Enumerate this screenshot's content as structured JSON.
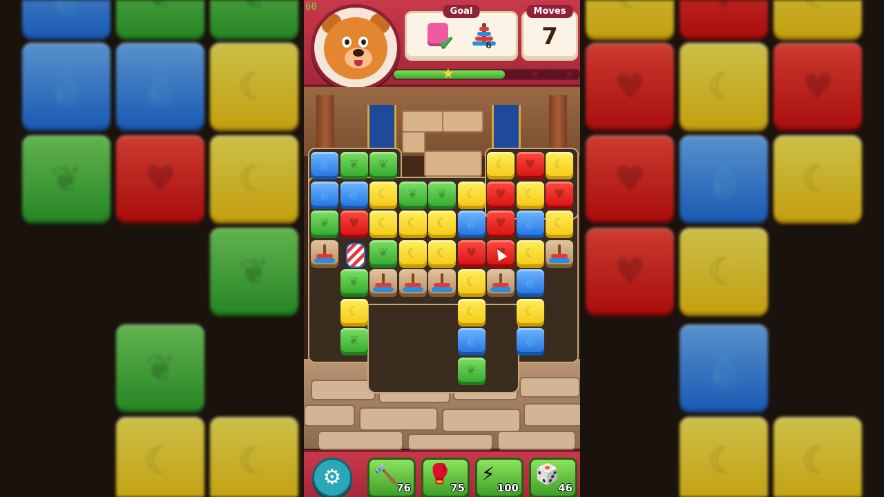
{
  "fps": "60",
  "header": {
    "goal_label": "Goal",
    "moves_label": "Moves",
    "moves_value": "7",
    "goal_stack_count": "6",
    "progress_fraction": 0.6,
    "colors": {
      "header": "#c8394a",
      "progress": "#3ea52f"
    }
  },
  "board": {
    "tile_colors": {
      "blue": "#1f6fde",
      "green": "#2ea62c",
      "yellow": "#f4c712",
      "red": "#d3100f"
    },
    "grid": [
      [
        "blue",
        "green",
        "green",
        null,
        null,
        null,
        "yellow",
        "red",
        "yellow"
      ],
      [
        "blue",
        "blue",
        "yellow",
        "green",
        "green",
        "yellow",
        "red",
        "yellow",
        "red"
      ],
      [
        "green",
        "red",
        "yellow",
        "yellow",
        "yellow",
        "blue",
        "red",
        "blue",
        "yellow"
      ],
      [
        "stack",
        "rocket",
        "green",
        "yellow",
        "yellow",
        "red",
        "red",
        "yellow",
        "stack"
      ],
      [
        null,
        "green",
        "stack",
        "stack",
        "stack",
        "yellow",
        "stack",
        "blue",
        null
      ],
      [
        null,
        "yellow",
        null,
        null,
        null,
        "yellow",
        null,
        "yellow",
        null
      ],
      [
        null,
        "green",
        null,
        null,
        null,
        "blue",
        null,
        "blue",
        null
      ],
      [
        null,
        null,
        null,
        null,
        null,
        "green",
        null,
        null,
        null
      ]
    ]
  },
  "boosters": [
    {
      "name": "hammer",
      "count": "76",
      "icon": "hammer-icon"
    },
    {
      "name": "boxing-glove",
      "count": "75",
      "icon": "boxing-glove-icon"
    },
    {
      "name": "drill",
      "count": "100",
      "icon": "drill-icon"
    },
    {
      "name": "dice",
      "count": "46",
      "icon": "dice-icon"
    }
  ]
}
